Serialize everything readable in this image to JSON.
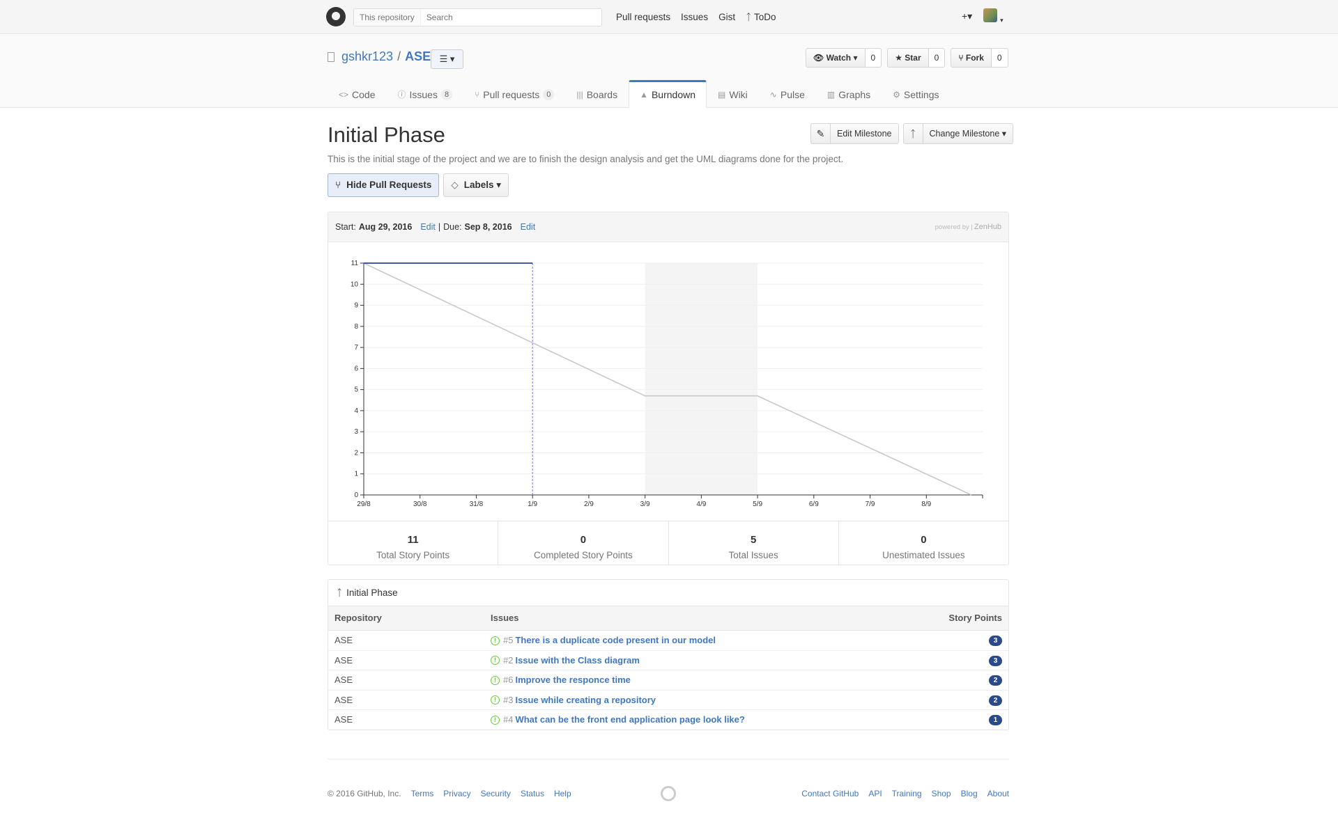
{
  "header": {
    "search_scope": "This repository",
    "search_placeholder": "Search",
    "nav": [
      "Pull requests",
      "Issues",
      "Gist",
      "ToDo"
    ],
    "plus": "+▾"
  },
  "repo": {
    "owner": "gshkr123",
    "separator": "/",
    "name": "ASE",
    "menu_icon": "☰ ▾",
    "watch": {
      "label": "Watch ▾",
      "count": "0"
    },
    "star": {
      "label": "Star",
      "count": "0"
    },
    "fork": {
      "label": "Fork",
      "count": "0"
    },
    "tabs": [
      {
        "label": "Code",
        "icon": "<>"
      },
      {
        "label": "Issues",
        "icon": "ⓘ",
        "count": "8"
      },
      {
        "label": "Pull requests",
        "icon": "⑂",
        "count": "0"
      },
      {
        "label": "Boards",
        "icon": "|||"
      },
      {
        "label": "Burndown",
        "icon": "▲"
      },
      {
        "label": "Wiki",
        "icon": "▤"
      },
      {
        "label": "Pulse",
        "icon": "∿"
      },
      {
        "label": "Graphs",
        "icon": "▥"
      },
      {
        "label": "Settings",
        "icon": "⚙"
      }
    ]
  },
  "milestone": {
    "title": "Initial Phase",
    "description": "This is the initial stage of the project and we are to finish the design analysis and get the UML diagrams done for the project.",
    "edit_label": "Edit Milestone",
    "change_label": "Change Milestone ▾",
    "hide_pr_label": "Hide Pull Requests",
    "labels_label": "Labels ▾"
  },
  "burndown": {
    "start_label": "Start:",
    "start_date": "Aug 29, 2016",
    "edit": "Edit",
    "divider": "|",
    "due_label": "Due:",
    "due_date": "Sep 8, 2016",
    "powered_by": "powered by |",
    "powered_brand": "ZenHub"
  },
  "chart_data": {
    "type": "line",
    "categories": [
      "29/8",
      "30/8",
      "31/8",
      "1/9",
      "2/9",
      "3/9",
      "4/9",
      "5/9",
      "6/9",
      "7/9",
      "8/9"
    ],
    "ylim": [
      0,
      11
    ],
    "yticks": [
      0,
      1,
      2,
      3,
      4,
      5,
      6,
      7,
      8,
      9,
      10,
      11
    ],
    "series": [
      {
        "color": "#c8c8c8",
        "points": [
          [
            0,
            11
          ],
          [
            5,
            4.7
          ],
          [
            7,
            4.7
          ],
          [
            10.8,
            0
          ]
        ]
      },
      {
        "color": "#2c3e9e",
        "points": [
          [
            0,
            11
          ],
          [
            3,
            11
          ]
        ]
      }
    ],
    "today_index": 3,
    "weekend_band": [
      5,
      7
    ],
    "grid": true
  },
  "stats": [
    {
      "value": "11",
      "label": "Total Story Points"
    },
    {
      "value": "0",
      "label": "Completed Story Points"
    },
    {
      "value": "5",
      "label": "Total Issues"
    },
    {
      "value": "0",
      "label": "Unestimated Issues"
    }
  ],
  "issue_table": {
    "title": "Initial Phase",
    "headers": [
      "Repository",
      "Issues",
      "Story Points"
    ],
    "rows": [
      {
        "repo": "ASE",
        "num": "#5",
        "title": "There is a duplicate code present in our model",
        "points": "3"
      },
      {
        "repo": "ASE",
        "num": "#2",
        "title": "Issue with the Class diagram",
        "points": "3"
      },
      {
        "repo": "ASE",
        "num": "#6",
        "title": "Improve the responce time",
        "points": "2"
      },
      {
        "repo": "ASE",
        "num": "#3",
        "title": "Issue while creating a repository",
        "points": "2"
      },
      {
        "repo": "ASE",
        "num": "#4",
        "title": "What can be the front end application page look like?",
        "points": "1"
      }
    ]
  },
  "footer": {
    "copyright": "© 2016 GitHub, Inc.",
    "left_links": [
      "Terms",
      "Privacy",
      "Security",
      "Status",
      "Help"
    ],
    "right_links": [
      "Contact GitHub",
      "API",
      "Training",
      "Shop",
      "Blog",
      "About"
    ]
  }
}
